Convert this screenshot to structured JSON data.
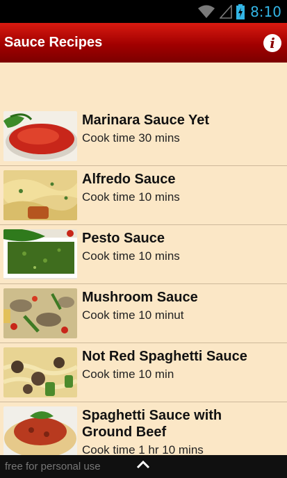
{
  "status": {
    "time": "8:10",
    "icons": [
      "wifi-icon",
      "signal-icon",
      "battery-charging-icon"
    ]
  },
  "appbar": {
    "title": "Sauce Recipes",
    "info_icon": "info-icon"
  },
  "recipes": [
    {
      "title": "Marinara Sauce Yet",
      "subtitle": "Cook time 30 mins"
    },
    {
      "title": "Alfredo Sauce",
      "subtitle": "Cook time 10 mins"
    },
    {
      "title": "Pesto Sauce",
      "subtitle": "Cook time 10 mins"
    },
    {
      "title": "Mushroom Sauce",
      "subtitle": "Cook time 10 minut"
    },
    {
      "title": "Not Red Spaghetti Sauce",
      "subtitle": "Cook time 10 min"
    },
    {
      "title": "Spaghetti Sauce with Ground Beef",
      "subtitle": "Cook time 1 hr 10 mins"
    }
  ],
  "footer": {
    "text": "free for personal use",
    "expand_icon": "chevron-up-icon"
  },
  "colors": {
    "accent": "#a10000",
    "background": "#fbe7c6",
    "status_time": "#33b5e5"
  }
}
